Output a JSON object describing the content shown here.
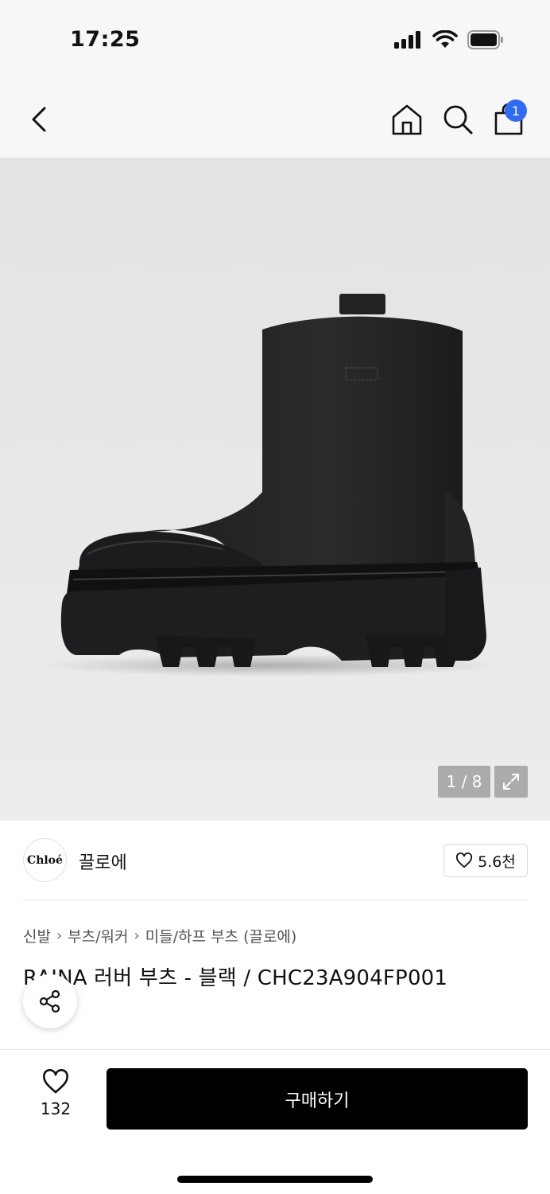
{
  "status_bar": {
    "time": "17:25"
  },
  "nav": {
    "cart_badge": "1"
  },
  "gallery": {
    "counter": "1 / 8"
  },
  "brand": {
    "logo_text": "Chloé",
    "name": "끌로에",
    "likes": "5.6천"
  },
  "breadcrumb": [
    "신발",
    "부츠/워커",
    "미들/하프 부츠 (끌로에)"
  ],
  "product": {
    "title": "RAINA 러버 부츠 - 블랙 / CHC23A904FP001"
  },
  "bottom_bar": {
    "wish_count": "132",
    "buy_label": "구매하기"
  },
  "icons": {
    "back": "chevron-left-icon",
    "home": "home-icon",
    "search": "search-icon",
    "bag": "shopping-bag-icon",
    "expand": "expand-icon",
    "share": "share-icon",
    "heart": "heart-icon"
  },
  "colors": {
    "accent": "#2f6af5",
    "buy_button": "#000000"
  }
}
